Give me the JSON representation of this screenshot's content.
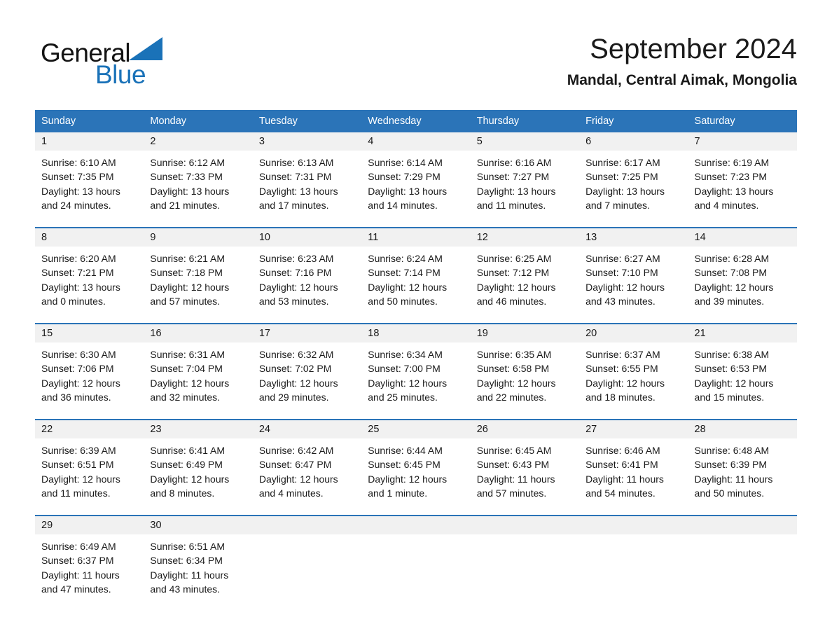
{
  "brand": {
    "name_part1": "General",
    "name_part2": "Blue",
    "triangle_color": "#1a72b8"
  },
  "header": {
    "month_title": "September 2024",
    "location": "Mandal, Central Aimak, Mongolia"
  },
  "colors": {
    "header_blue": "#2b74b8",
    "day_band_gray": "#f1f1f1",
    "text": "#1a1a1a",
    "brand_blue": "#1a72b8"
  },
  "calendar": {
    "weekdays": [
      "Sunday",
      "Monday",
      "Tuesday",
      "Wednesday",
      "Thursday",
      "Friday",
      "Saturday"
    ],
    "weeks": [
      [
        {
          "day": "1",
          "sunrise": "Sunrise: 6:10 AM",
          "sunset": "Sunset: 7:35 PM",
          "daylight_line1": "Daylight: 13 hours",
          "daylight_line2": "and 24 minutes."
        },
        {
          "day": "2",
          "sunrise": "Sunrise: 6:12 AM",
          "sunset": "Sunset: 7:33 PM",
          "daylight_line1": "Daylight: 13 hours",
          "daylight_line2": "and 21 minutes."
        },
        {
          "day": "3",
          "sunrise": "Sunrise: 6:13 AM",
          "sunset": "Sunset: 7:31 PM",
          "daylight_line1": "Daylight: 13 hours",
          "daylight_line2": "and 17 minutes."
        },
        {
          "day": "4",
          "sunrise": "Sunrise: 6:14 AM",
          "sunset": "Sunset: 7:29 PM",
          "daylight_line1": "Daylight: 13 hours",
          "daylight_line2": "and 14 minutes."
        },
        {
          "day": "5",
          "sunrise": "Sunrise: 6:16 AM",
          "sunset": "Sunset: 7:27 PM",
          "daylight_line1": "Daylight: 13 hours",
          "daylight_line2": "and 11 minutes."
        },
        {
          "day": "6",
          "sunrise": "Sunrise: 6:17 AM",
          "sunset": "Sunset: 7:25 PM",
          "daylight_line1": "Daylight: 13 hours",
          "daylight_line2": "and 7 minutes."
        },
        {
          "day": "7",
          "sunrise": "Sunrise: 6:19 AM",
          "sunset": "Sunset: 7:23 PM",
          "daylight_line1": "Daylight: 13 hours",
          "daylight_line2": "and 4 minutes."
        }
      ],
      [
        {
          "day": "8",
          "sunrise": "Sunrise: 6:20 AM",
          "sunset": "Sunset: 7:21 PM",
          "daylight_line1": "Daylight: 13 hours",
          "daylight_line2": "and 0 minutes."
        },
        {
          "day": "9",
          "sunrise": "Sunrise: 6:21 AM",
          "sunset": "Sunset: 7:18 PM",
          "daylight_line1": "Daylight: 12 hours",
          "daylight_line2": "and 57 minutes."
        },
        {
          "day": "10",
          "sunrise": "Sunrise: 6:23 AM",
          "sunset": "Sunset: 7:16 PM",
          "daylight_line1": "Daylight: 12 hours",
          "daylight_line2": "and 53 minutes."
        },
        {
          "day": "11",
          "sunrise": "Sunrise: 6:24 AM",
          "sunset": "Sunset: 7:14 PM",
          "daylight_line1": "Daylight: 12 hours",
          "daylight_line2": "and 50 minutes."
        },
        {
          "day": "12",
          "sunrise": "Sunrise: 6:25 AM",
          "sunset": "Sunset: 7:12 PM",
          "daylight_line1": "Daylight: 12 hours",
          "daylight_line2": "and 46 minutes."
        },
        {
          "day": "13",
          "sunrise": "Sunrise: 6:27 AM",
          "sunset": "Sunset: 7:10 PM",
          "daylight_line1": "Daylight: 12 hours",
          "daylight_line2": "and 43 minutes."
        },
        {
          "day": "14",
          "sunrise": "Sunrise: 6:28 AM",
          "sunset": "Sunset: 7:08 PM",
          "daylight_line1": "Daylight: 12 hours",
          "daylight_line2": "and 39 minutes."
        }
      ],
      [
        {
          "day": "15",
          "sunrise": "Sunrise: 6:30 AM",
          "sunset": "Sunset: 7:06 PM",
          "daylight_line1": "Daylight: 12 hours",
          "daylight_line2": "and 36 minutes."
        },
        {
          "day": "16",
          "sunrise": "Sunrise: 6:31 AM",
          "sunset": "Sunset: 7:04 PM",
          "daylight_line1": "Daylight: 12 hours",
          "daylight_line2": "and 32 minutes."
        },
        {
          "day": "17",
          "sunrise": "Sunrise: 6:32 AM",
          "sunset": "Sunset: 7:02 PM",
          "daylight_line1": "Daylight: 12 hours",
          "daylight_line2": "and 29 minutes."
        },
        {
          "day": "18",
          "sunrise": "Sunrise: 6:34 AM",
          "sunset": "Sunset: 7:00 PM",
          "daylight_line1": "Daylight: 12 hours",
          "daylight_line2": "and 25 minutes."
        },
        {
          "day": "19",
          "sunrise": "Sunrise: 6:35 AM",
          "sunset": "Sunset: 6:58 PM",
          "daylight_line1": "Daylight: 12 hours",
          "daylight_line2": "and 22 minutes."
        },
        {
          "day": "20",
          "sunrise": "Sunrise: 6:37 AM",
          "sunset": "Sunset: 6:55 PM",
          "daylight_line1": "Daylight: 12 hours",
          "daylight_line2": "and 18 minutes."
        },
        {
          "day": "21",
          "sunrise": "Sunrise: 6:38 AM",
          "sunset": "Sunset: 6:53 PM",
          "daylight_line1": "Daylight: 12 hours",
          "daylight_line2": "and 15 minutes."
        }
      ],
      [
        {
          "day": "22",
          "sunrise": "Sunrise: 6:39 AM",
          "sunset": "Sunset: 6:51 PM",
          "daylight_line1": "Daylight: 12 hours",
          "daylight_line2": "and 11 minutes."
        },
        {
          "day": "23",
          "sunrise": "Sunrise: 6:41 AM",
          "sunset": "Sunset: 6:49 PM",
          "daylight_line1": "Daylight: 12 hours",
          "daylight_line2": "and 8 minutes."
        },
        {
          "day": "24",
          "sunrise": "Sunrise: 6:42 AM",
          "sunset": "Sunset: 6:47 PM",
          "daylight_line1": "Daylight: 12 hours",
          "daylight_line2": "and 4 minutes."
        },
        {
          "day": "25",
          "sunrise": "Sunrise: 6:44 AM",
          "sunset": "Sunset: 6:45 PM",
          "daylight_line1": "Daylight: 12 hours",
          "daylight_line2": "and 1 minute."
        },
        {
          "day": "26",
          "sunrise": "Sunrise: 6:45 AM",
          "sunset": "Sunset: 6:43 PM",
          "daylight_line1": "Daylight: 11 hours",
          "daylight_line2": "and 57 minutes."
        },
        {
          "day": "27",
          "sunrise": "Sunrise: 6:46 AM",
          "sunset": "Sunset: 6:41 PM",
          "daylight_line1": "Daylight: 11 hours",
          "daylight_line2": "and 54 minutes."
        },
        {
          "day": "28",
          "sunrise": "Sunrise: 6:48 AM",
          "sunset": "Sunset: 6:39 PM",
          "daylight_line1": "Daylight: 11 hours",
          "daylight_line2": "and 50 minutes."
        }
      ],
      [
        {
          "day": "29",
          "sunrise": "Sunrise: 6:49 AM",
          "sunset": "Sunset: 6:37 PM",
          "daylight_line1": "Daylight: 11 hours",
          "daylight_line2": "and 47 minutes."
        },
        {
          "day": "30",
          "sunrise": "Sunrise: 6:51 AM",
          "sunset": "Sunset: 6:34 PM",
          "daylight_line1": "Daylight: 11 hours",
          "daylight_line2": "and 43 minutes."
        },
        {
          "day": "",
          "sunrise": "",
          "sunset": "",
          "daylight_line1": "",
          "daylight_line2": ""
        },
        {
          "day": "",
          "sunrise": "",
          "sunset": "",
          "daylight_line1": "",
          "daylight_line2": ""
        },
        {
          "day": "",
          "sunrise": "",
          "sunset": "",
          "daylight_line1": "",
          "daylight_line2": ""
        },
        {
          "day": "",
          "sunrise": "",
          "sunset": "",
          "daylight_line1": "",
          "daylight_line2": ""
        },
        {
          "day": "",
          "sunrise": "",
          "sunset": "",
          "daylight_line1": "",
          "daylight_line2": ""
        }
      ]
    ]
  }
}
